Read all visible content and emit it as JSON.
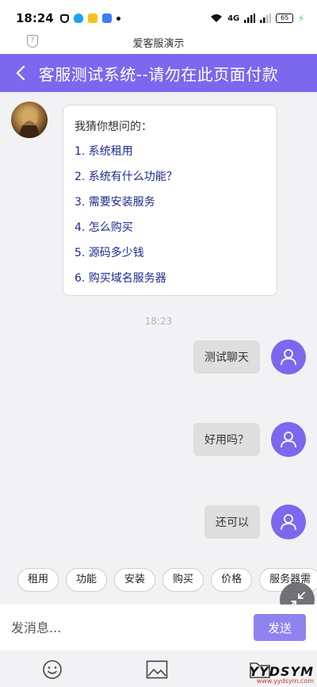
{
  "status_bar": {
    "time": "18:24",
    "network": "4G",
    "battery": "65"
  },
  "app_header": {
    "title": "爱客服演示"
  },
  "nav": {
    "title": "客服测试系统--请勿在此页面付款"
  },
  "bot_message": {
    "title": "我猜你想问的：",
    "items": [
      {
        "label": "1.  系统租用"
      },
      {
        "label": "2.  系统有什么功能？"
      },
      {
        "label": "3.  需要安装服务"
      },
      {
        "label": "4.  怎么购买"
      },
      {
        "label": "5.  源码多少钱"
      },
      {
        "label": "6.  购买域名服务器"
      }
    ]
  },
  "timestamp": "18:23",
  "user_messages": [
    {
      "text": "测试聊天"
    },
    {
      "text": "好用吗？"
    },
    {
      "text": "还可以"
    }
  ],
  "quick_replies": [
    {
      "label": "租用"
    },
    {
      "label": "功能"
    },
    {
      "label": "安装"
    },
    {
      "label": "购买"
    },
    {
      "label": "价格"
    },
    {
      "label": "服务器需"
    }
  ],
  "input": {
    "placeholder": "发消息...",
    "send_label": "发送"
  },
  "toolbar": {
    "icons": [
      "emoji-icon",
      "image-icon",
      "folder-icon"
    ]
  },
  "watermark": {
    "main": "YYDSYM",
    "sub": "www.yydsym.com"
  },
  "colors": {
    "primary": "#7b68ee",
    "send_button": "#8f83f0",
    "link": "#1e2a8c"
  }
}
